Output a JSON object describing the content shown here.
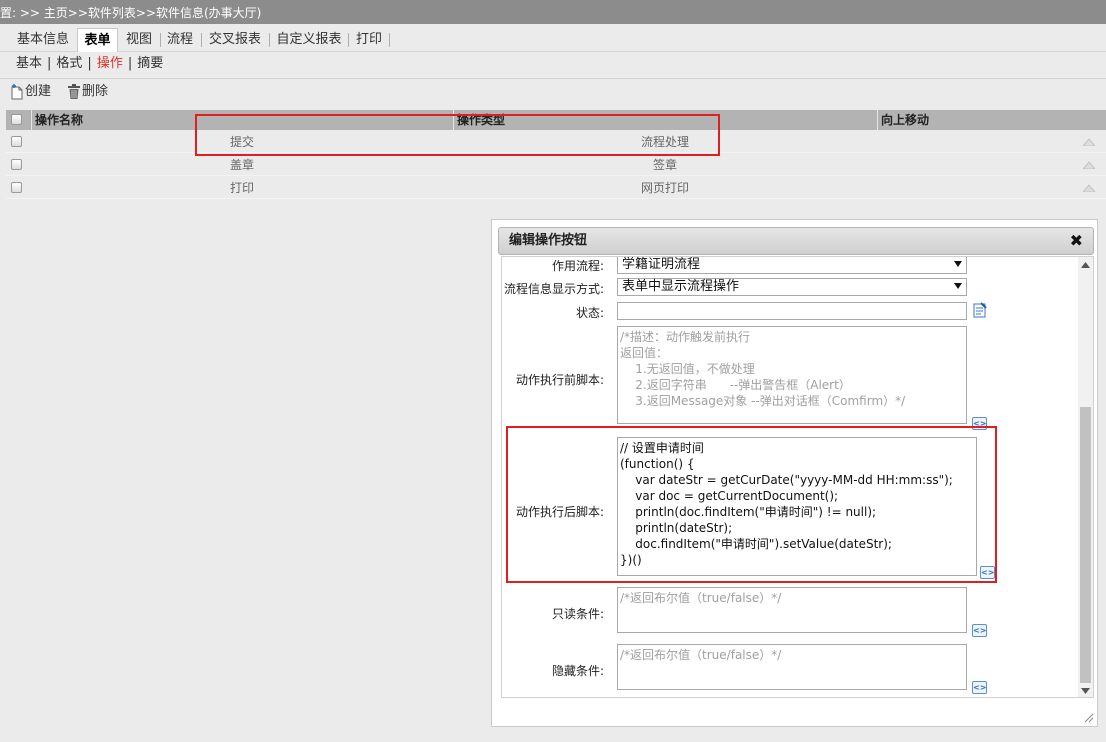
{
  "breadcrumb": "位置: >> 主页>>软件列表>>软件信息(办事大厅)",
  "tabs": [
    {
      "label": "基本信息"
    },
    {
      "label": "表单"
    },
    {
      "label": "视图"
    },
    {
      "label": "流程"
    },
    {
      "label": "交叉报表"
    },
    {
      "label": "自定义报表"
    },
    {
      "label": "打印"
    }
  ],
  "active_tab": "表单",
  "subtabs": [
    {
      "label": "基本"
    },
    {
      "label": "格式"
    },
    {
      "label": "操作"
    },
    {
      "label": "摘要"
    }
  ],
  "active_subtab": "操作",
  "toolbar": {
    "create_label": "创建",
    "delete_label": "删除"
  },
  "grid": {
    "columns": [
      "操作名称",
      "操作类型",
      "向上移动"
    ],
    "rows": [
      {
        "name": "提交",
        "type": "流程处理"
      },
      {
        "name": "盖章",
        "type": "签章"
      },
      {
        "name": "打印",
        "type": "网页打印"
      }
    ]
  },
  "dialog": {
    "title": "编辑操作按钮",
    "close_glyph": "✖",
    "flow_label": "作用流程:",
    "flow_value": "学籍证明流程",
    "display_label": "流程信息显示方式:",
    "display_value": "表单中显示流程操作",
    "status_label": "状态:",
    "status_value": "",
    "before_script_label": "动作执行前脚本:",
    "before_script_value": "/*描述：动作触发前执行\n返回值：\n    1.无返回值，不做处理\n    2.返回字符串      --弹出警告框（Alert）\n    3.返回Message对象 --弹出对话框（Comfirm）*/",
    "after_script_label": "动作执行后脚本:",
    "after_script_value": "// 设置申请时间\n(function() {\n    var dateStr = getCurDate(\"yyyy-MM-dd HH:mm:ss\");\n    var doc = getCurrentDocument();\n    println(doc.findItem(\"申请时间\") != null);\n    println(dateStr);\n    doc.findItem(\"申请时间\").setValue(dateStr);\n})()",
    "readonly_label": "只读条件:",
    "readonly_value": "/*返回布尔值（true/false）*/",
    "hidden_label": "隐藏条件:",
    "hidden_value": "/*返回布尔值（true/false）*/",
    "code_icon_glyph": "<>"
  },
  "colors": {
    "highlight": "#e02020",
    "active_subtab": "#d9322a",
    "breadcrumb_bg": "#8c8c8c"
  }
}
